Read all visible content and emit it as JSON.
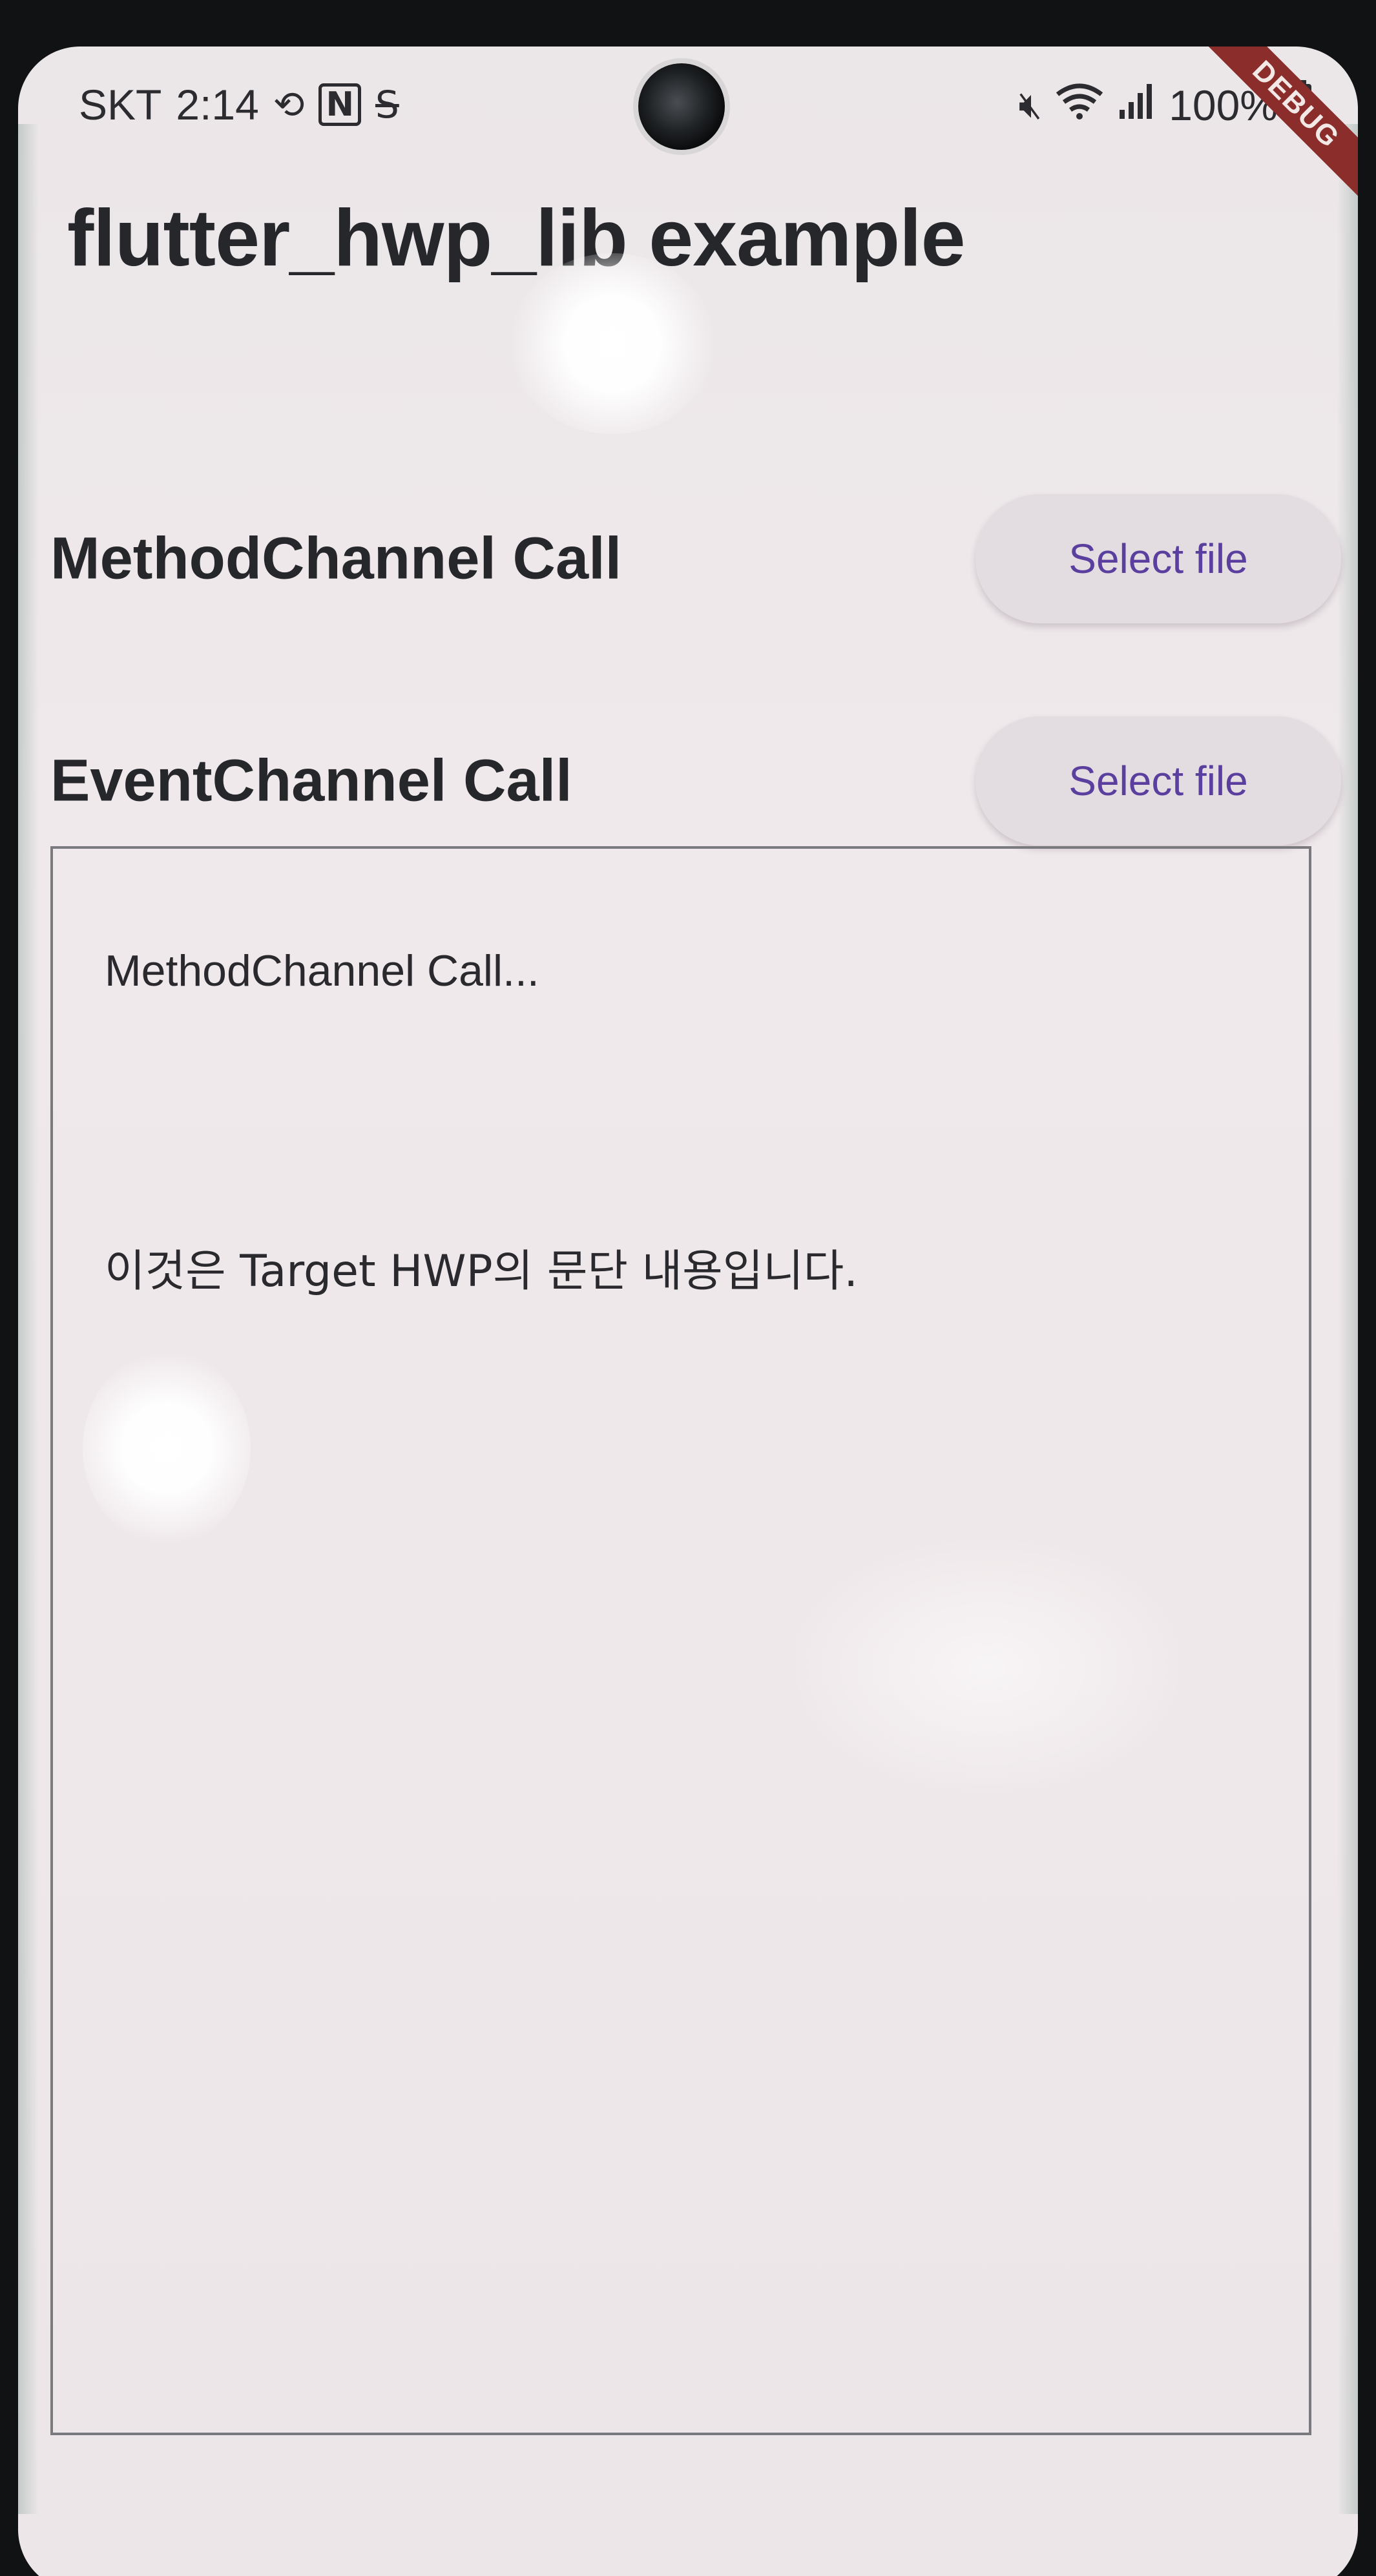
{
  "status_bar": {
    "carrier": "SKT",
    "time": "2:14",
    "left_icons": [
      "sync-icon",
      "nfc-icon",
      "s-icon"
    ],
    "right_icons": [
      "mute-icon",
      "wifi-icon",
      "signal-icon",
      "battery-icon"
    ],
    "battery": "100%"
  },
  "debug_banner": "DEBUG",
  "app_bar": {
    "title": "flutter_hwp_lib example"
  },
  "rows": [
    {
      "label": "MethodChannel Call",
      "button_label": "Select file"
    },
    {
      "label": "EventChannel Call",
      "button_label": "Select file"
    }
  ],
  "output": {
    "lines": [
      "MethodChannel Call...",
      "이것은 Target HWP의 문단 내용입니다."
    ]
  },
  "colors": {
    "button_text": "#5a3f9e",
    "button_bg": "#e3dde2",
    "background": "#ece6e9",
    "debug_ribbon": "#8a2d2b"
  }
}
